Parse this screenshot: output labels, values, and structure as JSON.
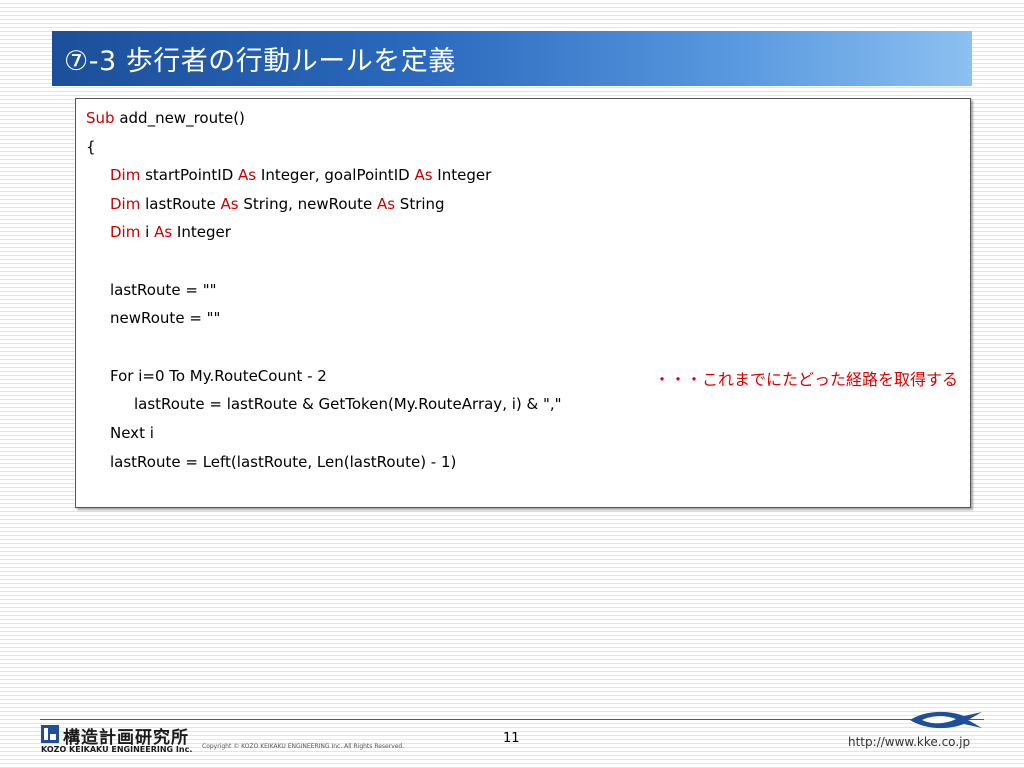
{
  "title": "⑦-3 歩行者の行動ルールを定義",
  "code": {
    "line1": {
      "kw1": "Sub",
      "rest": " add_new_route()"
    },
    "line2": {
      "text": "{"
    },
    "line3": {
      "kw1": "Dim",
      "p1": " startPointID ",
      "kw2": "As",
      "p2": " Integer, goalPointID ",
      "kw3": "As",
      "p3": " Integer"
    },
    "line4": {
      "kw1": "Dim",
      "p1": " lastRoute ",
      "kw2": "As",
      "p2": " String, newRoute ",
      "kw3": "As",
      "p3": " String"
    },
    "line5": {
      "kw1": "Dim",
      "p1": " i ",
      "kw2": "As",
      "p2": " Integer"
    },
    "line6": {
      "text": "lastRoute = \"\""
    },
    "line7": {
      "text": "newRoute = \"\""
    },
    "line8": {
      "text": "For i=0 To My.RouteCount - 2"
    },
    "line9": {
      "text": "lastRoute = lastRoute & GetToken(My.RouteArray, i) & \",\""
    },
    "line10": {
      "text": "Next i"
    },
    "line11": {
      "text": "lastRoute = Left(lastRoute, Len(lastRoute) - 1)"
    }
  },
  "annotation": "・・・これまでにたどった経路を取得する",
  "footer": {
    "logo_jp": "構造計画研究所",
    "logo_en": "KOZO KEIKAKU ENGINEERING Inc.",
    "copyright": "Copyright © KOZO KEIKAKU ENGINEERING Inc. All Rights Reserved.",
    "page_number": "11",
    "url": "http://www.kke.co.jp"
  },
  "colors": {
    "keyword": "#cc0000",
    "annotation": "#e00000",
    "title_bar_start": "#1c4f99",
    "title_bar_end": "#8cc0f0"
  }
}
